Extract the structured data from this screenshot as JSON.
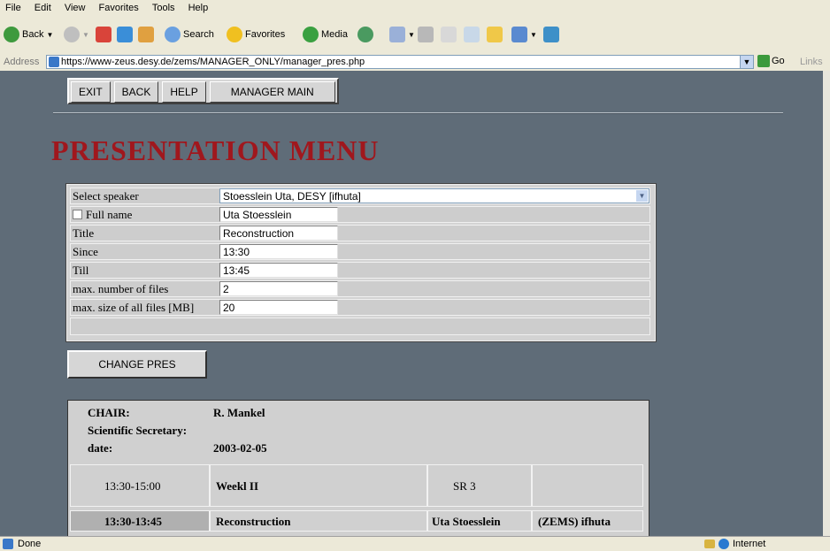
{
  "browser": {
    "menu": [
      "File",
      "Edit",
      "View",
      "Favorites",
      "Tools",
      "Help"
    ],
    "toolbar": {
      "back": "Back",
      "search": "Search",
      "favorites": "Favorites",
      "media": "Media"
    },
    "address_label": "Address",
    "url": "https://www-zeus.desy.de/zems/MANAGER_ONLY/manager_pres.php",
    "go": "Go",
    "links": "Links",
    "status": "Done",
    "zone": "Internet"
  },
  "nav": {
    "exit": "EXIT",
    "back": "BACK",
    "help": "HELP",
    "manager_main": "MANAGER MAIN"
  },
  "page_title": "PRESENTATION MENU",
  "form": {
    "select_speaker_label": "Select speaker",
    "select_speaker_value": "Stoesslein Uta, DESY [ifhuta]",
    "full_name_label": "Full name",
    "full_name_value": "Uta Stoesslein",
    "title_label": "Title",
    "title_value": "Reconstruction",
    "since_label": "Since",
    "since_value": "13:30",
    "till_label": "Till",
    "till_value": "13:45",
    "max_files_label": "max. number of files",
    "max_files_value": "2",
    "max_size_label": "max. size of all files [MB]",
    "max_size_value": "20"
  },
  "change_button": "CHANGE PRES",
  "presentation": {
    "chair_label": "CHAIR:",
    "chair_value": "R. Mankel",
    "secretary_label": "Scientific Secretary:",
    "date_label": "date:",
    "date_value": "2003-02-05",
    "session_time": "13:30-15:00",
    "session_name": "Weekl II",
    "session_room": "SR 3",
    "talk_time": "13:30-13:45",
    "talk_title": "Reconstruction",
    "talk_speaker": "Uta Stoesslein",
    "talk_account": "(ZEMS) ifhuta"
  }
}
